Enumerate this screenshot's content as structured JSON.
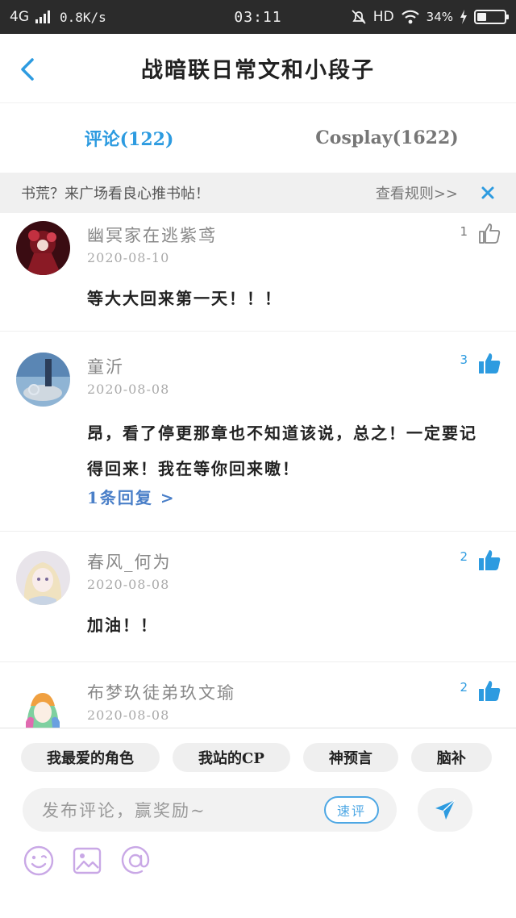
{
  "status_bar": {
    "network": "4G",
    "speed": "0.8K/s",
    "time": "03:11",
    "hd": "HD",
    "battery": "34%",
    "battery_level": 0.34
  },
  "header": {
    "title": "战暗联日常文和小段子"
  },
  "tabs": [
    {
      "label": "评论(122)",
      "active": true
    },
    {
      "label": "Cosplay(1622)",
      "active": false
    }
  ],
  "notice": {
    "text": "书荒？来广场看良心推书帖！",
    "link": "查看规则>>"
  },
  "comments": [
    {
      "name": "幽冥家在逃紫鸢",
      "date": "2020-08-10",
      "body": "等大大回来第一天！！！",
      "likes": "1",
      "liked": false,
      "reply": ""
    },
    {
      "name": "童沂",
      "date": "2020-08-08",
      "body": "昂，看了停更那章也不知道该说，总之！一定要记得回来！我在等你回来嗷！",
      "likes": "3",
      "liked": true,
      "reply": "1条回复 >"
    },
    {
      "name": "春风_何为",
      "date": "2020-08-08",
      "body": "加油！！",
      "likes": "2",
      "liked": true,
      "reply": ""
    },
    {
      "name": "布梦玖徒弟玖文瑜",
      "date": "2020-08-08",
      "body": "",
      "likes": "2",
      "liked": true,
      "reply": ""
    }
  ],
  "topics": [
    "我最爱的角色",
    "我站的CP",
    "神预言",
    "脑补"
  ],
  "input": {
    "placeholder": "发布评论，赢奖励~",
    "quick_review": "速评"
  },
  "colors": {
    "accent": "#2d9be0",
    "link": "#4a7fc8",
    "tool_icon": "#c9a8e6"
  }
}
